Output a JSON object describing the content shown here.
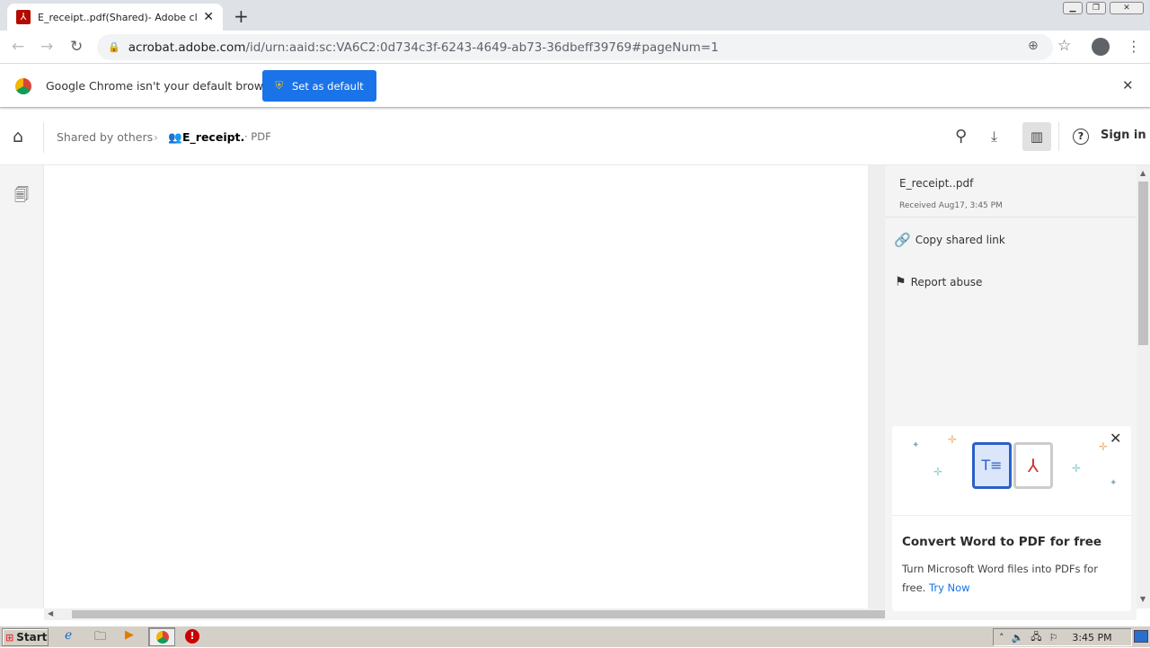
{
  "browser": {
    "tab_title": "E_receipt..pdf(Shared)- Adobe cloud",
    "url_host": "acrobat.adobe.com",
    "url_path": "/id/urn:aaid:sc:VA6C2:0d734c3f-6243-4649-ab73-36dbeff39769#pageNum=1"
  },
  "infobar": {
    "message": "Google Chrome isn't your default browser",
    "button": "Set as default"
  },
  "header": {
    "breadcrumb_parent": "Shared by others",
    "file_name": "E_receipt.",
    "file_type": "· PDF",
    "sign_in": "Sign in"
  },
  "panel": {
    "file_name": "E_receipt..pdf",
    "received": "Received Aug17, 3:45 PM",
    "actions": [
      {
        "label": "Copy shared link",
        "icon": "link-icon"
      },
      {
        "label": "Report abuse",
        "icon": "flag-icon"
      }
    ]
  },
  "promo": {
    "title": "Convert Word to PDF for free",
    "body": "Turn Microsoft Word files into PDFs for free.",
    "link": "Try Now"
  },
  "taskbar": {
    "start": "Start",
    "clock": "3:45 PM"
  },
  "colors": {
    "accent": "#1a73e8",
    "adobe_red": "#b30b00"
  }
}
